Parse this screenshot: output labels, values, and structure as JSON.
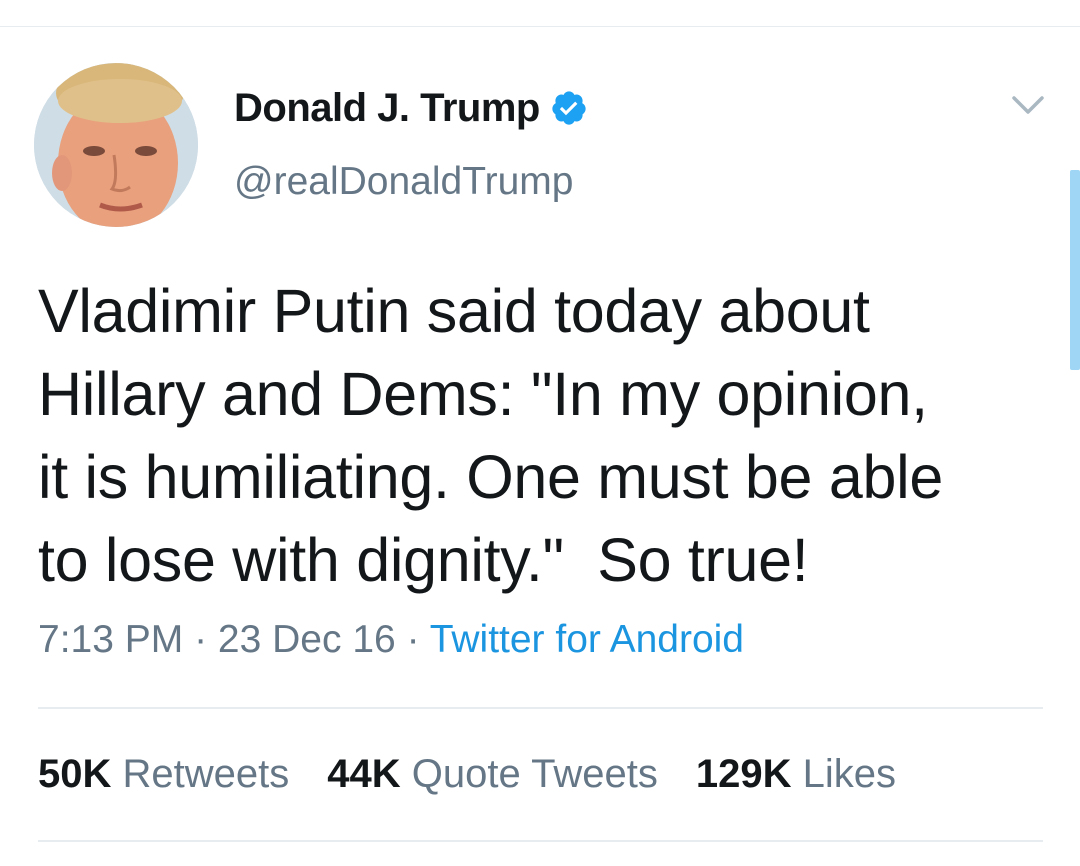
{
  "tweet": {
    "author": {
      "display_name": "Donald J. Trump",
      "handle": "@realDonaldTrump",
      "verified": true,
      "avatar_icon": "profile-photo"
    },
    "text": "Vladimir Putin said today about\nHillary and Dems: \"In my opinion,\nit is humiliating. One must be able\nto lose with dignity.\"  So true!",
    "time": "7:13 PM",
    "date": "23 Dec 16",
    "separator": "·",
    "source": "Twitter for Android",
    "stats": {
      "retweets_count": "50K",
      "retweets_label": "Retweets",
      "quotes_count": "44K",
      "quotes_label": "Quote Tweets",
      "likes_count": "129K",
      "likes_label": "Likes"
    }
  },
  "colors": {
    "text_primary": "#14171a",
    "text_secondary": "#657786",
    "link_blue": "#1b95e0",
    "divider": "#e6ecf0"
  }
}
